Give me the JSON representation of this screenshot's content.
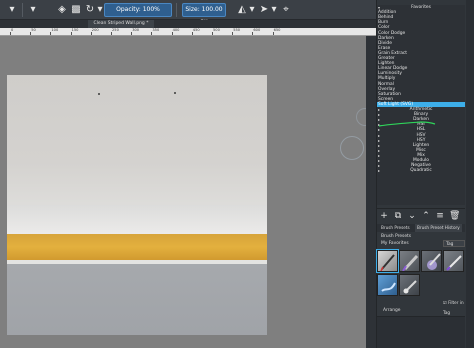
{
  "toolbar": {
    "opacity_label": "Opacity: 100%",
    "size_label": "Size: 100.00 px",
    "icons": [
      "brush-settings-icon",
      "eraser-icon",
      "alpha-lock-icon",
      "reload-icon",
      "mirror-icon",
      "wrap-icon",
      "transform-icon"
    ]
  },
  "document": {
    "tab_title": "Clean Striped Wall.png *"
  },
  "ruler": {
    "ticks": [
      "0",
      "50",
      "100",
      "150",
      "200",
      "250",
      "300",
      "350",
      "400",
      "450",
      "500",
      "550",
      "600",
      "650"
    ]
  },
  "blend_modes": {
    "header": "Favorites",
    "favorites": [
      "Addition",
      "Behind",
      "Burn",
      "Color",
      "Color Dodge",
      "Darken",
      "Divide",
      "Erase",
      "Grain Extract",
      "Greater",
      "Lighten",
      "Linear Dodge",
      "Luminosity",
      "Multiply",
      "Normal",
      "Overlay",
      "Saturation",
      "Screen",
      "Soft Light (SVG)"
    ],
    "selected": "Soft Light (SVG)",
    "categories": [
      "Arithmetic",
      "Binary",
      "Darken",
      "HSI",
      "HSL",
      "HSV",
      "HSY",
      "Lighten",
      "Misc",
      "Mix",
      "Modulo",
      "Negative",
      "Quadratic"
    ]
  },
  "brush_presets": {
    "tabs": [
      "Brush Presets",
      "Brush Preset History"
    ],
    "title": "Brush Presets",
    "filter": "My Favorites",
    "tag_button": "Tag",
    "filter_in_tag": "Filter in Tag",
    "arrange_label": "Arrange"
  },
  "colors": {
    "selection": "#3daee9",
    "wall_stripe": "#e0ac3c",
    "panel_bg": "#31363b"
  }
}
